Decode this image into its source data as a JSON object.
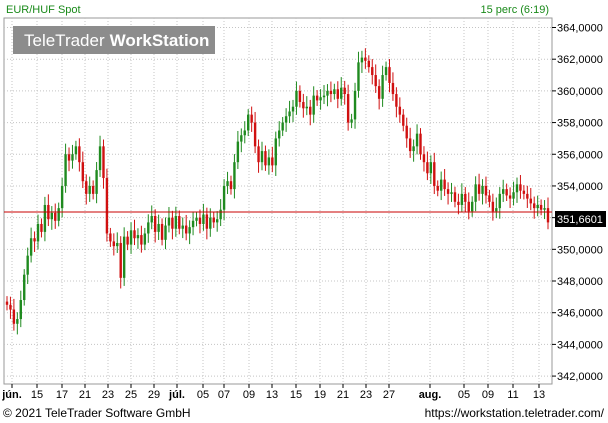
{
  "header": {
    "instrument": "EUR/HUF Spot",
    "interval": "15 perc (6:19)",
    "logo_light": "TeleTrader",
    "logo_bold": "WorkStation"
  },
  "footer": {
    "copyright": "© 2021  TeleTrader Software GmbH",
    "url": "https://workstation.teletrader.com/"
  },
  "colors": {
    "up": "#1f8a1f",
    "down": "#d01010",
    "grid": "#bdbdbd",
    "reference_line": "#c80000",
    "price_tag_bg": "#000000",
    "price_tag_text": "#ffffff"
  },
  "chart_data": {
    "type": "candlestick",
    "title": "EUR/HUF Spot",
    "ylim": [
      341.5,
      364.6
    ],
    "y_ticks": [
      "342,0000",
      "344,0000",
      "346,0000",
      "348,0000",
      "350,0000",
      "352,0000",
      "354,0000",
      "356,0000",
      "358,0000",
      "360,0000",
      "362,0000",
      "364,0000"
    ],
    "x_ticks": [
      "jún.",
      "15",
      "17",
      "21",
      "23",
      "25",
      "29",
      "júl.",
      "05",
      "07",
      "09",
      "13",
      "15",
      "19",
      "21",
      "23",
      "27",
      "aug.",
      "05",
      "09",
      "11",
      "13"
    ],
    "last_price": 351.6601,
    "last_price_label": "351,6601",
    "reference_level": 352.0,
    "grid": true,
    "series": [
      {
        "values": [
          346.5,
          346.2,
          345.3,
          345.6,
          346.8,
          348.4,
          349.6,
          350.7,
          350.5,
          351.6,
          351.1,
          352.8,
          351.9,
          352.3,
          351.8,
          352.6,
          354.0,
          356.0,
          355.6,
          356.0,
          356.5,
          355.5,
          354.3,
          353.5,
          354.0,
          353.5,
          355.0,
          356.5,
          354.5,
          351.0,
          350.5,
          350.2,
          350.4,
          348.2,
          350.8,
          350.3,
          351.2,
          350.7,
          350.9,
          350.3,
          351.0,
          351.7,
          352.1,
          351.1,
          351.6,
          350.6,
          351.5,
          352.0,
          351.3,
          352.1,
          351.3,
          351.5,
          351.0,
          351.4,
          351.8,
          352.0,
          351.6,
          352.2,
          351.3,
          352.0,
          351.7,
          351.9,
          352.5,
          354.0,
          354.3,
          353.8,
          355.5,
          356.8,
          357.2,
          357.5,
          358.5,
          358.0,
          356.5,
          355.5,
          356.2,
          355.3,
          355.8,
          355.3,
          357.0,
          357.5,
          358.0,
          358.4,
          358.7,
          359.0,
          360.0,
          359.3,
          358.9,
          359.0,
          358.5,
          359.7,
          359.4,
          359.6,
          359.7,
          360.0,
          359.8,
          360.1,
          359.5,
          360.2,
          359.8,
          358.0,
          358.2,
          360.0,
          361.8,
          362.1,
          361.9,
          361.5,
          361.0,
          360.3,
          359.5,
          361.0,
          361.5,
          360.5,
          359.8,
          359.0,
          358.5,
          357.8,
          357.0,
          356.2,
          356.5,
          357.3,
          356.0,
          355.5,
          354.8,
          355.5,
          354.0,
          353.7,
          354.4,
          353.8,
          353.5,
          353.6,
          353.0,
          352.8,
          353.5,
          353.0,
          352.4,
          353.0,
          354.1,
          353.5,
          354.0,
          353.4,
          353.0,
          352.4,
          352.6,
          353.5,
          353.8,
          353.4,
          353.2,
          353.6,
          354.1,
          353.7,
          353.5,
          353.2,
          352.9,
          352.6,
          352.8,
          352.5,
          352.6,
          351.7
        ]
      }
    ]
  }
}
